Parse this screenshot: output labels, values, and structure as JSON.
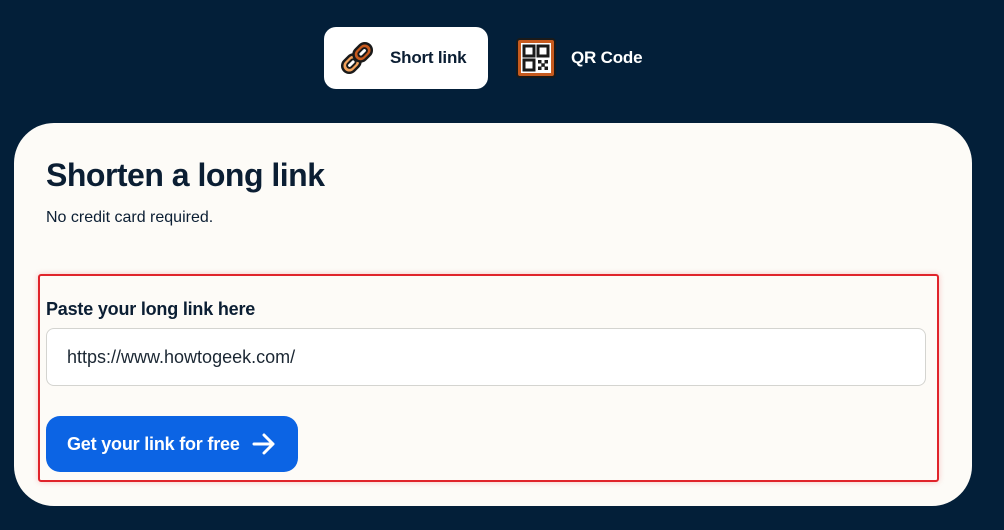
{
  "tabs": [
    {
      "label": "Short link",
      "icon": "link-icon",
      "active": true
    },
    {
      "label": "QR Code",
      "icon": "qr-code-icon",
      "active": false
    }
  ],
  "card": {
    "title": "Shorten a long link",
    "subtitle": "No credit card required.",
    "field_label": "Paste your long link here",
    "url_value": "https://www.howtogeek.com/",
    "cta_label": "Get your link for free",
    "cta_icon": "arrow-right-icon"
  },
  "colors": {
    "background": "#031f39",
    "card": "#fdfbf7",
    "button": "#0c64e4",
    "icon_accent": "#c75a1e",
    "highlight": "#e0242b"
  }
}
